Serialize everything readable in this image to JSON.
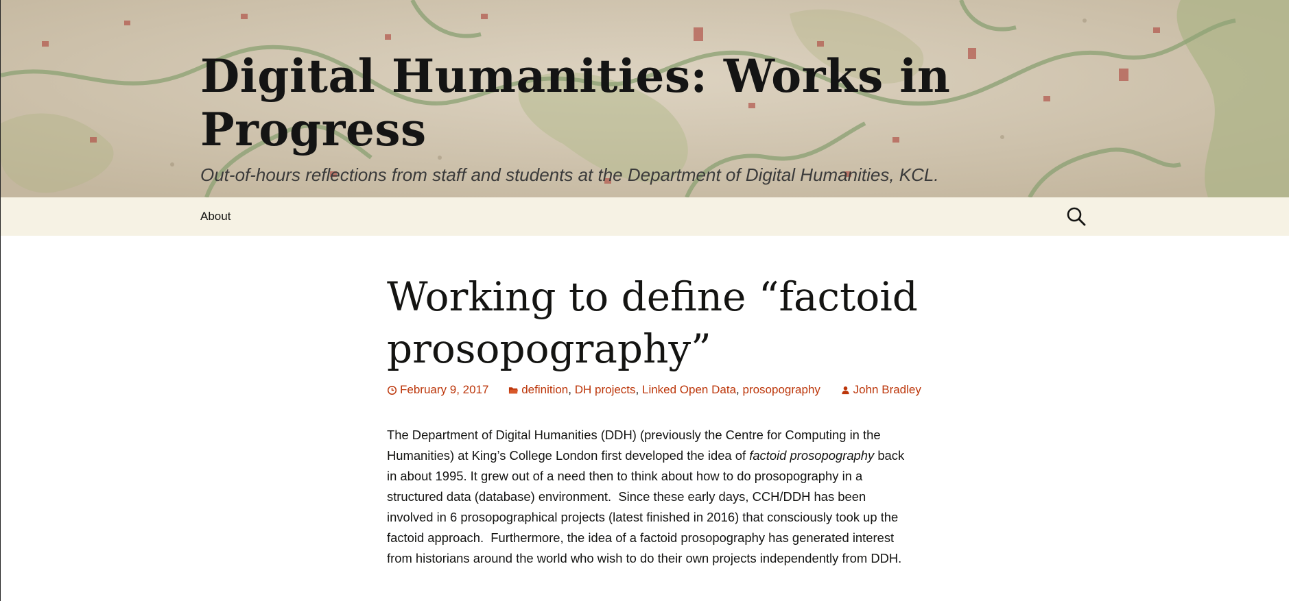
{
  "site": {
    "title": "Digital Humanities: Works in Progress",
    "description": "Out-of-hours reflections from staff and students at the Department of Digital Humanities, KCL."
  },
  "nav": {
    "items": [
      {
        "label": "About"
      }
    ],
    "search_icon": "search-icon"
  },
  "post": {
    "title": "Working to define “factoid prosopography”",
    "date": "February 9, 2017",
    "date_icon": "clock-icon",
    "categories_icon": "folder-icon",
    "categories": [
      {
        "label": "definition"
      },
      {
        "label": "DH projects"
      },
      {
        "label": "Linked Open Data"
      },
      {
        "label": "prosopography"
      }
    ],
    "author_icon": "person-icon",
    "author": "John Bradley",
    "content": {
      "p1_before": "The Department of Digital Humanities (DDH) (previously the Centre for Computing in the Humanities) at King’s College London first developed the idea of ",
      "p1_em": "factoid prosopography",
      "p1_after": " back in about 1995. It grew out of a need then to think about how to do prosopography in a structured data (database) environment.  Since these early days, CCH/DDH has been involved in 6 prosopographical projects (latest finished in 2016) that consciously took up the factoid approach.  Furthermore, the idea of a factoid prosopography has generated interest from historians around the world who wish to do their own projects independently from DDH."
    }
  },
  "colors": {
    "accent": "#bc360a",
    "navbar_bg": "#f6f2e4",
    "text": "#141412"
  }
}
